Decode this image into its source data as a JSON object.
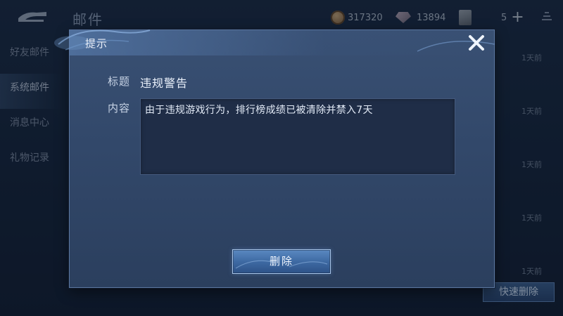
{
  "header": {
    "title": "邮件",
    "gold": "317320",
    "diamonds": "13894",
    "cards": "5"
  },
  "sidebar": {
    "items": [
      {
        "label": "好友邮件"
      },
      {
        "label": "系统邮件"
      },
      {
        "label": "消息中心"
      },
      {
        "label": "礼物记录"
      }
    ]
  },
  "mail_list": {
    "times": [
      "1天前",
      "1天前",
      "1天前",
      "1天前",
      "1天前"
    ]
  },
  "quick_delete_label": "快速删除",
  "dialog": {
    "title": "提示",
    "subject_label": "标题",
    "subject_value": "违规警告",
    "content_label": "内容",
    "content_value": "由于违规游戏行为，排行榜成绩已被清除并禁入7天",
    "delete_label": "删除"
  },
  "colors": {
    "dialog_bg": "#32486a",
    "button": "#3e6aa3",
    "content_bg": "#1f2d47"
  },
  "icons": [
    "back-icon",
    "gold-coin-icon",
    "diamond-icon",
    "card-icon",
    "plus-icon",
    "signal-icon",
    "close-icon"
  ]
}
